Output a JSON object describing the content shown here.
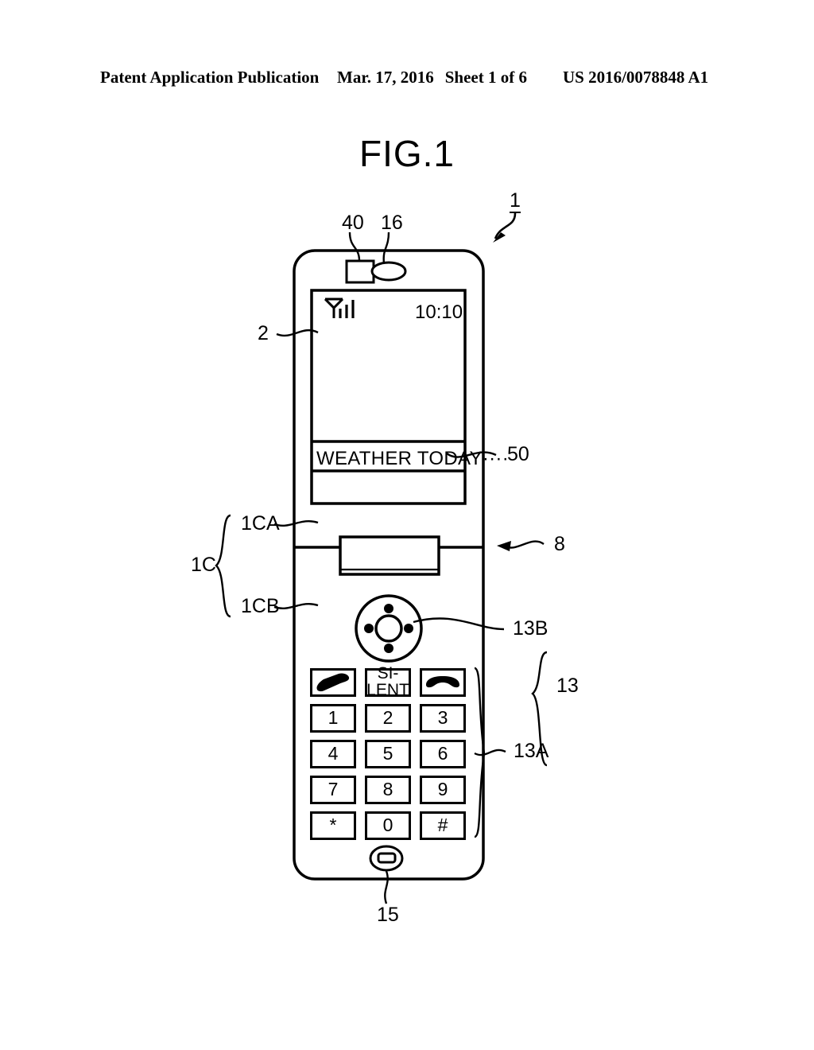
{
  "header": {
    "left": "Patent Application Publication",
    "date": "Mar. 17, 2016",
    "sheet": "Sheet 1 of 6",
    "publication_number": "US 2016/0078848 A1"
  },
  "figure": {
    "title": "FIG.1"
  },
  "device": {
    "screen": {
      "signal_icon": "antenna-signal-bars-icon",
      "clock": "10:10",
      "ticker": "WEATHER TODAY····"
    },
    "camera_icon": "camera-square-icon",
    "speaker_icon": "speaker-oval-icon",
    "microphone_icon": "microphone-icon",
    "dpad_icon": "directional-pad-icon"
  },
  "keys": {
    "function_row": [
      {
        "id": "call",
        "label": "",
        "icon": "handset-call-icon"
      },
      {
        "id": "silent",
        "label": "SI-\nLENT",
        "icon": ""
      },
      {
        "id": "end",
        "label": "",
        "icon": "handset-end-icon"
      }
    ],
    "numeric": [
      [
        "1",
        "2",
        "3"
      ],
      [
        "4",
        "5",
        "6"
      ],
      [
        "7",
        "8",
        "9"
      ],
      [
        "*",
        "0",
        "#"
      ]
    ]
  },
  "reference_numerals": {
    "device": "1",
    "display": "2",
    "camera": "40",
    "speaker": "16",
    "ticker": "50",
    "hinge_section": "1C",
    "hinge_upper": "1CA",
    "hinge_lower": "1CB",
    "hinge_axis": "8",
    "operation_unit": "13",
    "keypad": "13A",
    "dpad": "13B",
    "microphone": "15"
  },
  "colors": {
    "line": "#000000",
    "background": "#ffffff"
  }
}
